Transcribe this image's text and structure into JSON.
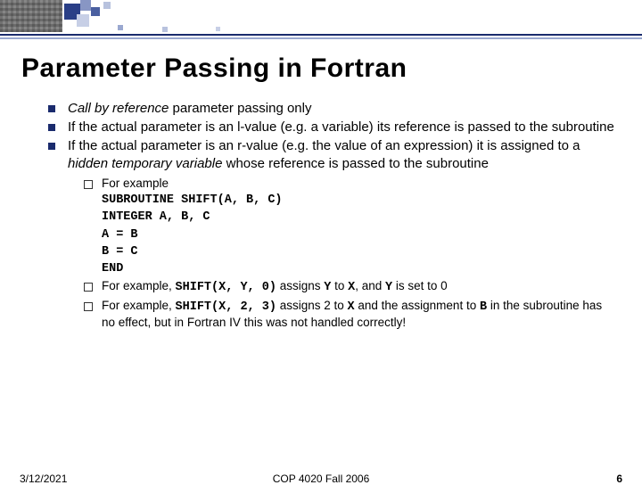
{
  "title": "Parameter Passing in Fortran",
  "bullets": {
    "p1a": "Call by reference",
    "p1b": " parameter passing only",
    "p2": "If the actual parameter is an l-value (e.g. a variable) its reference is passed to the subroutine",
    "p3a": "If the actual parameter is an r-value (e.g. the value of an expression) it is assigned to a ",
    "p3b": "hidden temporary variable",
    "p3c": " whose reference is passed to the subroutine"
  },
  "sub": {
    "s1_intro": "For example",
    "code1": "SUBROUTINE SHIFT(A, B, C)",
    "code2": "INTEGER A, B, C",
    "code3": "A = B",
    "code4": "B = C",
    "code5": "END",
    "s2a": "For example, ",
    "s2code": "SHIFT(X, Y, 0)",
    "s2b": " assigns ",
    "s2y": "Y",
    "s2c": " to ",
    "s2x": "X",
    "s2d": ", and ",
    "s2y2": "Y",
    "s2e": " is set to 0",
    "s3a": "For example, ",
    "s3code": "SHIFT(X, 2, 3)",
    "s3b": " assigns 2 to ",
    "s3x": "X",
    "s3c": " and the assignment to ",
    "s3B": "B",
    "s3d": " in the subroutine has no effect, but in Fortran IV this was not handled correctly!"
  },
  "footer": {
    "date": "3/12/2021",
    "course": "COP 4020 Fall 2006",
    "page": "6"
  }
}
